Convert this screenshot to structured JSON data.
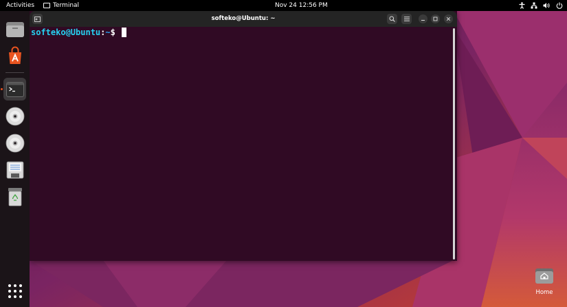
{
  "topbar": {
    "activities_label": "Activities",
    "app_name": "Terminal",
    "clock": "Nov 24  12:56 PM"
  },
  "dock": {
    "items": [
      {
        "name": "files",
        "icon": "files-icon"
      },
      {
        "name": "app-center",
        "icon": "app-center-icon"
      },
      {
        "name": "terminal",
        "icon": "terminal-icon",
        "active": true
      },
      {
        "name": "disc-1",
        "icon": "cd-icon"
      },
      {
        "name": "disc-2",
        "icon": "cd-icon"
      },
      {
        "name": "floppy",
        "icon": "floppy-icon"
      },
      {
        "name": "trash",
        "icon": "trash-icon"
      },
      {
        "name": "show-apps",
        "icon": "app-grid-icon"
      }
    ]
  },
  "terminal": {
    "title": "softeko@Ubuntu: ~",
    "prompt_user": "softeko@Ubuntu",
    "prompt_sep": ":",
    "prompt_path": "~",
    "prompt_symbol": "$"
  },
  "desktop": {
    "home_label": "Home"
  },
  "colors": {
    "terminal_bg": "#300a24",
    "accent": "#e95420",
    "prompt_user": "#26d0f0"
  }
}
